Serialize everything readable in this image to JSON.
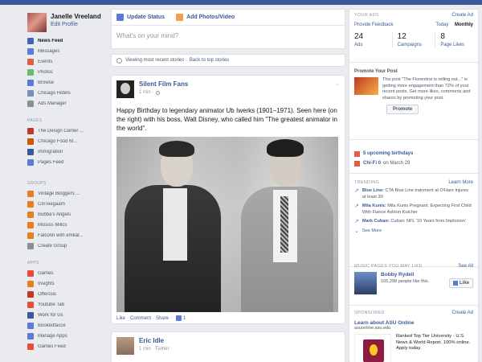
{
  "profile": {
    "name": "Janelle Vreeland",
    "edit": "Edit Profile"
  },
  "left_nav": [
    {
      "label": "News Feed",
      "count": "",
      "color": "#4267b2",
      "icon": "news-feed-icon",
      "active": true
    },
    {
      "label": "Messages",
      "count": "",
      "color": "#5b7bd5",
      "icon": "messages-icon"
    },
    {
      "label": "Events",
      "count": "",
      "color": "#e25c4a",
      "icon": "events-icon"
    },
    {
      "label": "Photos",
      "count": "",
      "color": "#6bb96a",
      "icon": "photos-icon"
    },
    {
      "label": "Browse",
      "count": "",
      "color": "#5b7bd5",
      "icon": "browse-icon"
    },
    {
      "label": "Chicago Hotels",
      "count": "",
      "color": "#7a8dbd",
      "icon": "page-icon"
    },
    {
      "label": "Ads Manager",
      "count": "",
      "color": "#8a8f99",
      "icon": "ads-manager-icon"
    }
  ],
  "pages_head": "PAGES",
  "pages_nav": [
    {
      "label": "The Design Center ...",
      "count": "",
      "color": "#c0392b",
      "icon": "page-icon"
    },
    {
      "label": "Chicago Food M...",
      "count": "",
      "color": "#d35400",
      "icon": "page-icon"
    },
    {
      "label": "Immigration",
      "count": "",
      "color": "#3b5998",
      "icon": "page-icon"
    },
    {
      "label": "Pages Feed",
      "count": "",
      "color": "#5b7bd5",
      "icon": "pages-feed-icon"
    }
  ],
  "groups_head": "GROUPS",
  "groups_nav": [
    {
      "label": "Vintage Bloggers ...",
      "count": "",
      "color": "#e67e22",
      "icon": "group-icon"
    },
    {
      "label": "CinTeegaarn",
      "count": "",
      "color": "#e67e22",
      "icon": "group-icon"
    },
    {
      "label": "Bubba's Angels",
      "count": "",
      "color": "#e67e22",
      "icon": "group-icon"
    },
    {
      "label": "Mississ Millcs",
      "count": "",
      "color": "#e67e22",
      "icon": "group-icon"
    },
    {
      "label": "Falconn with emkat...",
      "count": "",
      "color": "#e67e22",
      "icon": "group-icon"
    },
    {
      "label": "Create Group",
      "count": "",
      "color": "#8a8f99",
      "icon": "create-group-icon"
    }
  ],
  "apps_head": "APPS",
  "apps_nav": [
    {
      "label": "Games",
      "count": "",
      "color": "#e74c3c",
      "icon": "games-icon"
    },
    {
      "label": "Insights",
      "count": "",
      "color": "#e67e22",
      "icon": "insights-icon"
    },
    {
      "label": "Offerous",
      "count": "",
      "color": "#c0392b",
      "icon": "offers-icon"
    },
    {
      "label": "Youtube Tab",
      "count": "",
      "color": "#e74c3c",
      "icon": "youtube-icon"
    },
    {
      "label": "Work for Us",
      "count": "",
      "color": "#3b5998",
      "icon": "work-icon"
    },
    {
      "label": "Bookedfacce",
      "count": "",
      "color": "#5b7bd5",
      "icon": "app-icon"
    },
    {
      "label": "Manage Apps",
      "count": "",
      "color": "#5b7bd5",
      "icon": "manage-apps-icon"
    },
    {
      "label": "Games Feed",
      "count": "",
      "color": "#e74c3c",
      "icon": "games-feed-icon"
    }
  ],
  "composer": {
    "update_status": "Update Status",
    "add_photos": "Add Photos/Video",
    "placeholder": "What's on your mind?"
  },
  "notice": {
    "text": "Viewing most recent stories ·",
    "link": "Back to top stories"
  },
  "post": {
    "author": "Silent Film Fans",
    "time": "1 min ·",
    "text": "Happy Birthday to legendary animator Ub Iwerks (1901–1971). Seen here (on the right) with his boss, Walt Disney, who called him \"The greatest animator in the world\".",
    "actions": {
      "like": "Like",
      "comment": "Comment",
      "share": "Share",
      "like_count": "1"
    }
  },
  "post2": {
    "author": "Eric Idle",
    "time": "1 min · Twitter ·"
  },
  "ads": {
    "head": "YOUR ADS",
    "create": "Create Ad",
    "feedback": "Provide Feedback",
    "today": "Today",
    "monthly": "Monthly",
    "stats": [
      {
        "num": "24",
        "lab": "Ads"
      },
      {
        "num": "12",
        "lab": "Campaigns"
      },
      {
        "num": "8",
        "lab": "Page Likes"
      }
    ]
  },
  "promote": {
    "title": "Promote Your Post",
    "desc": "This post \"The Florentine is rolling out...\" is getting more engagement than 72% of your recent posts. Get more likes, comments and shares by promoting your post.",
    "button": "Promote"
  },
  "events": [
    {
      "bold": "5 upcoming birthdays",
      "rest": "",
      "icon": "birthday-icon",
      "color": "#e25c4a"
    },
    {
      "bold": "Chi-Fi 0",
      "rest": "on March 29",
      "icon": "event-icon",
      "color": "#e25c4a"
    }
  ],
  "trending": {
    "head": "TRENDING",
    "learn": "Learn More",
    "see_more": "See More",
    "items": [
      {
        "topic": "Blue Line:",
        "text": "CTA Blue Line trainment at O'Hare injures at least 30"
      },
      {
        "topic": "Mila Kunis:",
        "text": "Mila Kunis Pregnant; Expecting First Child With Fiance Ashton Kutcher"
      },
      {
        "topic": "Mark Cuban:",
        "text": "Cuban: NFL '10 Years from Implosion'"
      }
    ]
  },
  "music": {
    "head": "MUSIC PAGES YOU MAY LIKE",
    "see_all": "See All",
    "name": "Bobby Rydell",
    "likes": "105,298 people like this.",
    "like_btn": "Like"
  },
  "sponsored": {
    "head": "SPONSORED",
    "create": "Create Ad",
    "title": "Learn about ASU Online",
    "url": "asuonline.asu.edu",
    "desc": "Ranked Top Tier University - U.S. News & World Report. 100% online. Apply today."
  }
}
